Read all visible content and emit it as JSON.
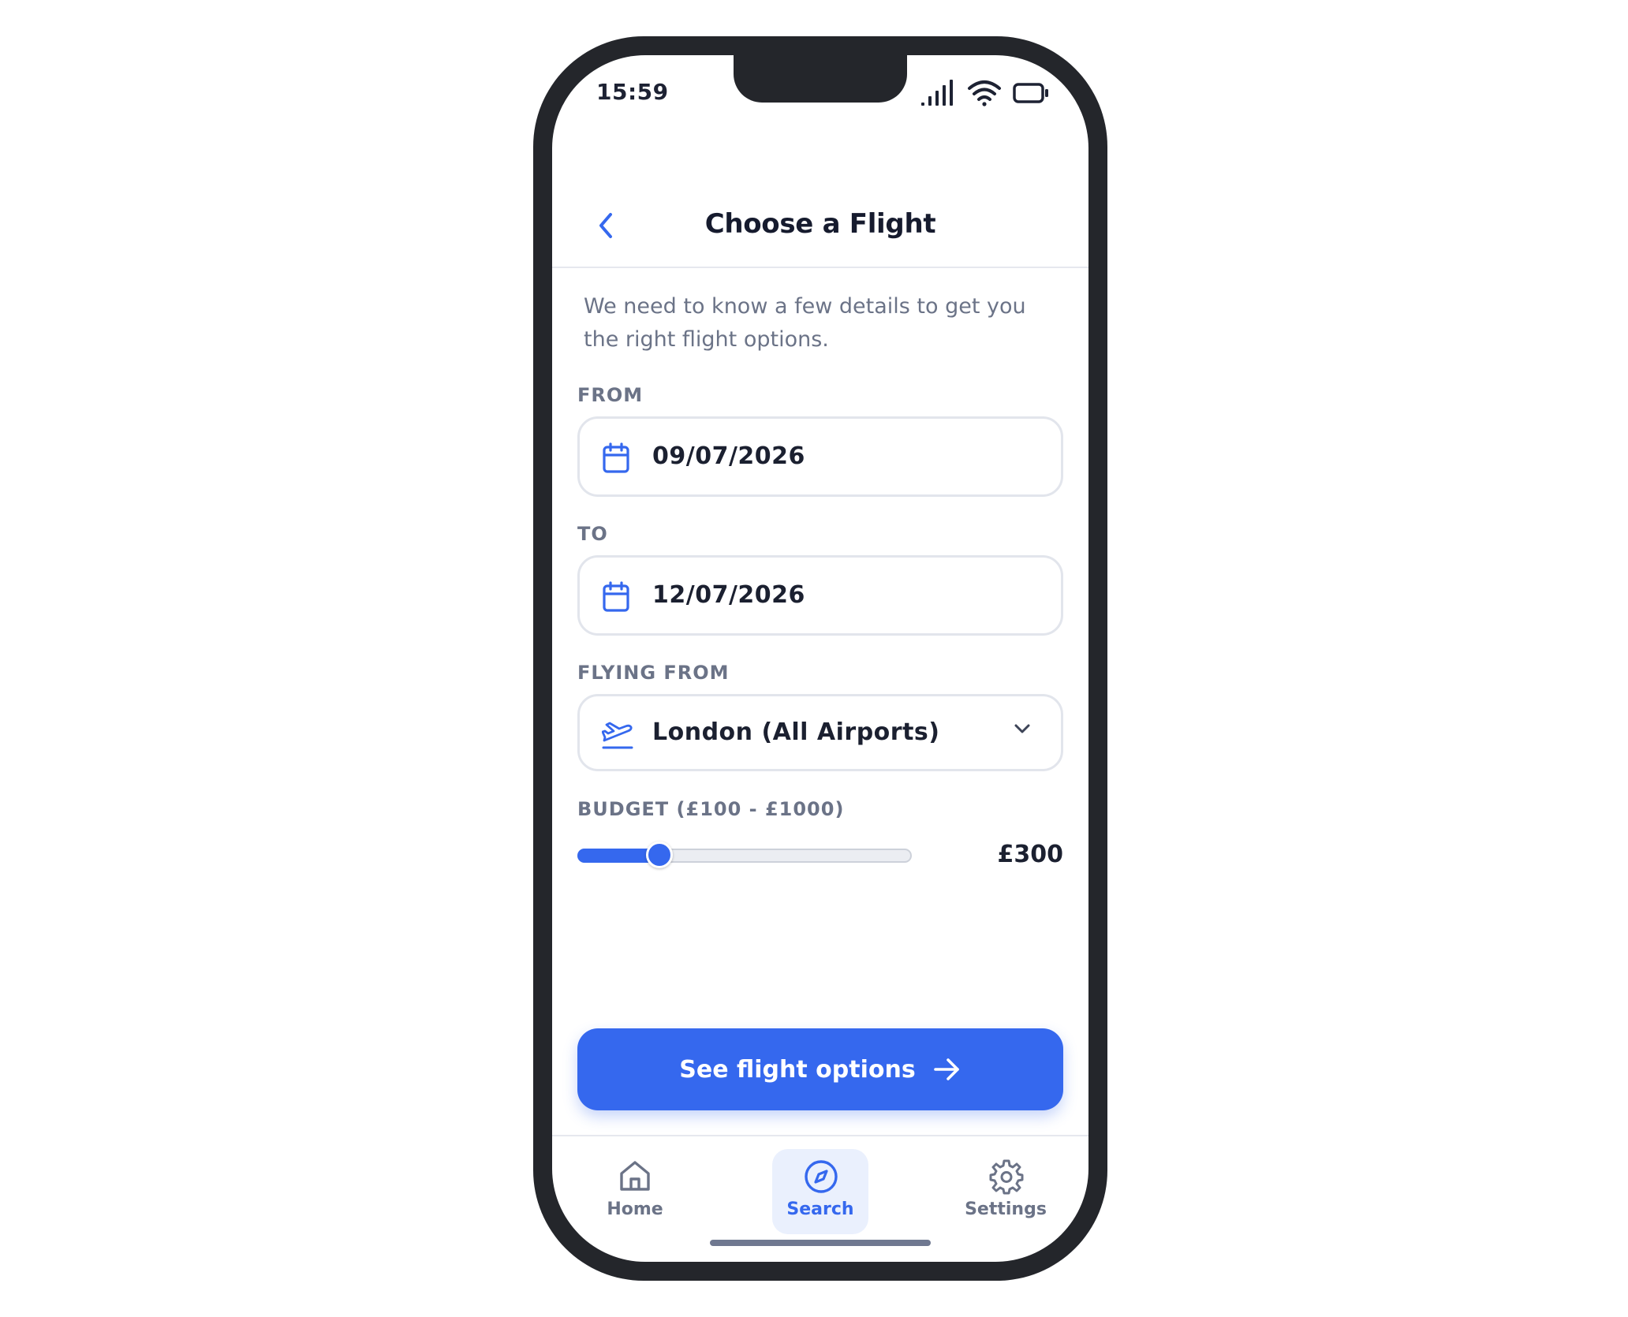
{
  "status_bar": {
    "time": "15:59",
    "icons": [
      "signal-icon",
      "wifi-icon",
      "battery-icon"
    ]
  },
  "header": {
    "title": "Choose a Flight",
    "back_icon": "chevron-left-icon"
  },
  "intro_text": "We need to know a few details to get you the right flight options.",
  "form": {
    "from": {
      "label": "FROM",
      "value": "09/07/2026",
      "icon": "calendar-icon"
    },
    "to": {
      "label": "TO",
      "value": "12/07/2026",
      "icon": "calendar-icon"
    },
    "flying_from": {
      "label": "FLYING FROM",
      "value": "London (All Airports)",
      "icon": "plane-takeoff-icon"
    },
    "budget": {
      "label": "BUDGET (£100 - £1000)",
      "min": 100,
      "max": 1000,
      "value": 300,
      "value_label": "£300"
    }
  },
  "cta": {
    "label": "See flight options",
    "icon": "arrow-right-icon"
  },
  "nav": {
    "items": [
      {
        "label": "Home",
        "icon": "home-icon",
        "active": false
      },
      {
        "label": "Search",
        "icon": "compass-icon",
        "active": true
      },
      {
        "label": "Settings",
        "icon": "gear-icon",
        "active": false
      }
    ]
  },
  "colors": {
    "accent": "#3568ee",
    "frame": "#24262b",
    "text_primary": "#1b2030",
    "text_muted": "#6b7387"
  }
}
